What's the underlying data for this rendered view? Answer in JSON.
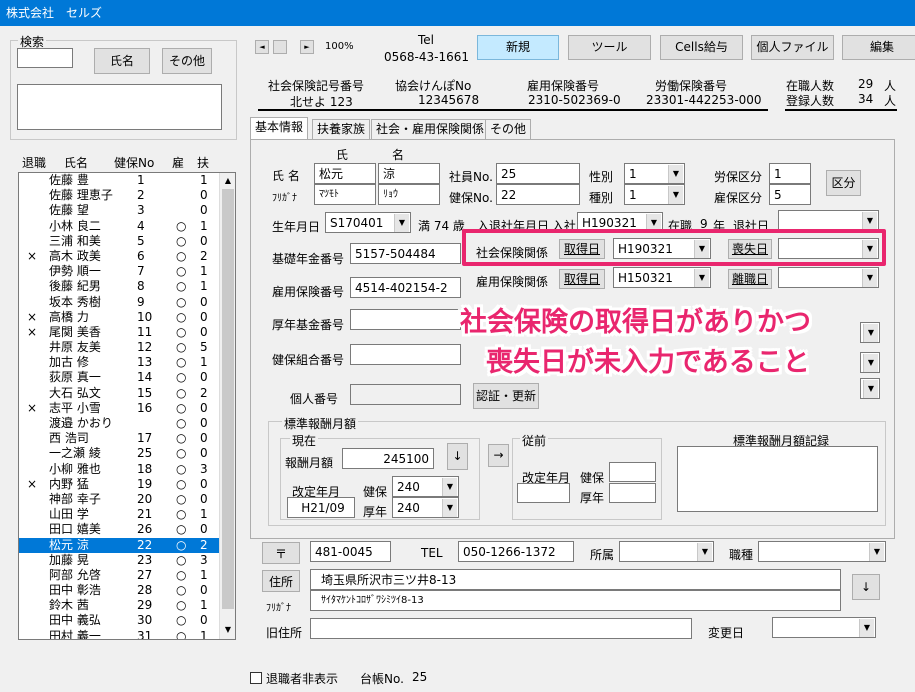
{
  "title": "株式会社　セルズ",
  "search": {
    "legend": "検索",
    "name_btn": "氏名",
    "other_btn": "その他"
  },
  "list_headers": {
    "taishoku": "退職",
    "name": "氏名",
    "kenpo": "健保No",
    "yatoi": "雇",
    "fu": "扶"
  },
  "employees": [
    {
      "x": "",
      "name": "佐藤 豊",
      "no": "1",
      "yatoi": "",
      "fu": "1"
    },
    {
      "x": "",
      "name": "佐藤 理恵子",
      "no": "2",
      "yatoi": "",
      "fu": "0"
    },
    {
      "x": "",
      "name": "佐藤 望",
      "no": "3",
      "yatoi": "",
      "fu": "0"
    },
    {
      "x": "",
      "name": "小林 良二",
      "no": "4",
      "yatoi": "○",
      "fu": "1"
    },
    {
      "x": "",
      "name": "三浦 和美",
      "no": "5",
      "yatoi": "○",
      "fu": "0"
    },
    {
      "x": "×",
      "name": "高木 政美",
      "no": "6",
      "yatoi": "○",
      "fu": "2"
    },
    {
      "x": "",
      "name": "伊勢 順一",
      "no": "7",
      "yatoi": "○",
      "fu": "1"
    },
    {
      "x": "",
      "name": "後藤 紀男",
      "no": "8",
      "yatoi": "○",
      "fu": "1"
    },
    {
      "x": "",
      "name": "坂本 秀樹",
      "no": "9",
      "yatoi": "○",
      "fu": "0"
    },
    {
      "x": "×",
      "name": "高橋 力",
      "no": "10",
      "yatoi": "○",
      "fu": "0"
    },
    {
      "x": "×",
      "name": "尾関 美香",
      "no": "11",
      "yatoi": "○",
      "fu": "0"
    },
    {
      "x": "",
      "name": "井原 友美",
      "no": "12",
      "yatoi": "○",
      "fu": "5"
    },
    {
      "x": "",
      "name": "加古 修",
      "no": "13",
      "yatoi": "○",
      "fu": "1"
    },
    {
      "x": "",
      "name": "荻原 真一",
      "no": "14",
      "yatoi": "○",
      "fu": "0"
    },
    {
      "x": "",
      "name": "大石 弘文",
      "no": "15",
      "yatoi": "○",
      "fu": "2"
    },
    {
      "x": "×",
      "name": "志平 小雪",
      "no": "16",
      "yatoi": "○",
      "fu": "0"
    },
    {
      "x": "",
      "name": "渡邉 かおり",
      "no": "",
      "yatoi": "○",
      "fu": "0"
    },
    {
      "x": "",
      "name": "西 浩司",
      "no": "17",
      "yatoi": "○",
      "fu": "0"
    },
    {
      "x": "",
      "name": "一之瀬 綾",
      "no": "25",
      "yatoi": "○",
      "fu": "0"
    },
    {
      "x": "",
      "name": "小柳 雅也",
      "no": "18",
      "yatoi": "○",
      "fu": "3"
    },
    {
      "x": "×",
      "name": "内野 猛",
      "no": "19",
      "yatoi": "○",
      "fu": "0"
    },
    {
      "x": "",
      "name": "神部 幸子",
      "no": "20",
      "yatoi": "○",
      "fu": "0"
    },
    {
      "x": "",
      "name": "山田 学",
      "no": "21",
      "yatoi": "○",
      "fu": "1"
    },
    {
      "x": "",
      "name": "田口 嬉美",
      "no": "26",
      "yatoi": "○",
      "fu": "0"
    },
    {
      "x": "",
      "name": "松元 涼",
      "no": "22",
      "yatoi": "○",
      "fu": "2",
      "sel": true
    },
    {
      "x": "",
      "name": "加藤 晃",
      "no": "23",
      "yatoi": "○",
      "fu": "3"
    },
    {
      "x": "",
      "name": "阿部 允啓",
      "no": "27",
      "yatoi": "○",
      "fu": "1"
    },
    {
      "x": "",
      "name": "田中 彰浩",
      "no": "28",
      "yatoi": "○",
      "fu": "0"
    },
    {
      "x": "",
      "name": "鈴木 茜",
      "no": "29",
      "yatoi": "○",
      "fu": "1"
    },
    {
      "x": "",
      "name": "田中 義弘",
      "no": "30",
      "yatoi": "○",
      "fu": "0"
    },
    {
      "x": "",
      "name": "田村 義一",
      "no": "31",
      "yatoi": "○",
      "fu": "1"
    }
  ],
  "nav": {
    "zoom": "100%",
    "tel_label": "Tel",
    "tel": "0568-43-1661"
  },
  "toolbar": {
    "new": "新規",
    "tool": "ツール",
    "cells": "Cells給与",
    "file": "個人ファイル",
    "edit": "編集"
  },
  "header_info": {
    "shaho_label": "社会保険記号番号",
    "shaho_val": "北せよ 123",
    "kyokai_label": "協会けんぽNo",
    "kyokai_val": "12345678",
    "koyo_label": "雇用保険番号",
    "koyo_val": "2310-502369-0",
    "rodo_label": "労働保険番号",
    "rodo_val": "23301-442253-000",
    "zaishoku_label": "在職人数",
    "zaishoku_val": "29",
    "touroku_label": "登録人数",
    "touroku_val": "34",
    "unit": "人"
  },
  "tabs": [
    "基本情報",
    "扶養家族",
    "社会・雇用保険関係",
    "その他"
  ],
  "form": {
    "name_label": "氏 名",
    "sei_label": "氏",
    "mei_label": "名",
    "sei": "松元",
    "mei": "涼",
    "furigana_label": "ﾌﾘｶﾞﾅ",
    "sei_kana": "ﾏﾂﾓﾄ",
    "mei_kana": "ﾘｮｳ",
    "shain_label": "社員No.",
    "shain_val": "25",
    "kenpo_label": "健保No.",
    "kenpo_val": "22",
    "seibetsu_label": "性別",
    "seibetsu_val": "1",
    "shubetsu_label": "種別",
    "shubetsu_val": "1",
    "rouho_label": "労保区分",
    "rouho_val": "1",
    "koho_label": "雇保区分",
    "koho_val": "5",
    "kubun_btn": "区分",
    "birth_label": "生年月日",
    "birth_val": "S170401",
    "age_text": "満 74 歳",
    "nyusha_label": "入退社年月日",
    "nyusha_sub": "入社",
    "nyusha_val": "H190321",
    "zaishoku_text": "在職",
    "nen": "9",
    "nen_label": "年",
    "taisha_label": "退社日",
    "kiso_label": "基礎年金番号",
    "kiso_val": "5157-504484",
    "shaho_kankei": "社会保険関係",
    "shutoku_btn": "取得日",
    "shutoku_val": "H190321",
    "soshitsu_btn": "喪失日",
    "koyo_label": "雇用保険番号",
    "koyo_val": "4514-402154-2",
    "koyo_kankei": "雇用保険関係",
    "koyo_shutoku_btn": "取得日",
    "koyo_shutoku_val": "H150321",
    "rishoku_btn": "離職日",
    "kounen_label": "厚年基金番号",
    "kumiai_label": "健保組合番号",
    "kojin_label": "個人番号",
    "ninsho_btn": "認証・更新",
    "hyojun_legend": "標準報酬月額",
    "genzai_legend": "現在",
    "houshu_label": "報酬月額",
    "houshu_val": "245100",
    "kaitei_label": "改定年月",
    "kaitei_val": "H21/09",
    "kenpo2_label": "健保",
    "kenpo2_val": "240",
    "kounen2_label": "厚年",
    "kounen2_val": "240",
    "juzen_legend": "従前",
    "juzen_kaitei": "改定年月",
    "juzen_kenpo": "健保",
    "juzen_kounen": "厚年",
    "kiroku_label": "標準報酬月額記録",
    "yubin_btn": "〒",
    "yubin_val": "481-0045",
    "tel_label": "TEL",
    "tel_val": "050-1266-1372",
    "shozoku_label": "所属",
    "shokushu_label": "職種",
    "jusho_btn": "住所",
    "jusho_val": "埼玉県所沢市三ツ井8-13",
    "kana_label": "ﾌﾘｶﾞﾅ",
    "jusho_kana": "ｻｲﾀﾏｹﾝﾄｺﾛｻﾞﾜｼﾐﾂｲ8-13",
    "kyu_label": "旧住所",
    "henko_label": "変更日"
  },
  "footer": {
    "hide_label": "退職者非表示",
    "daicho_label": "台帳No.",
    "daicho_val": "25"
  },
  "annotation": {
    "line1": "社会保険の取得日がありかつ",
    "line2": "喪失日が未入力であること",
    "color": "#e9266e"
  }
}
